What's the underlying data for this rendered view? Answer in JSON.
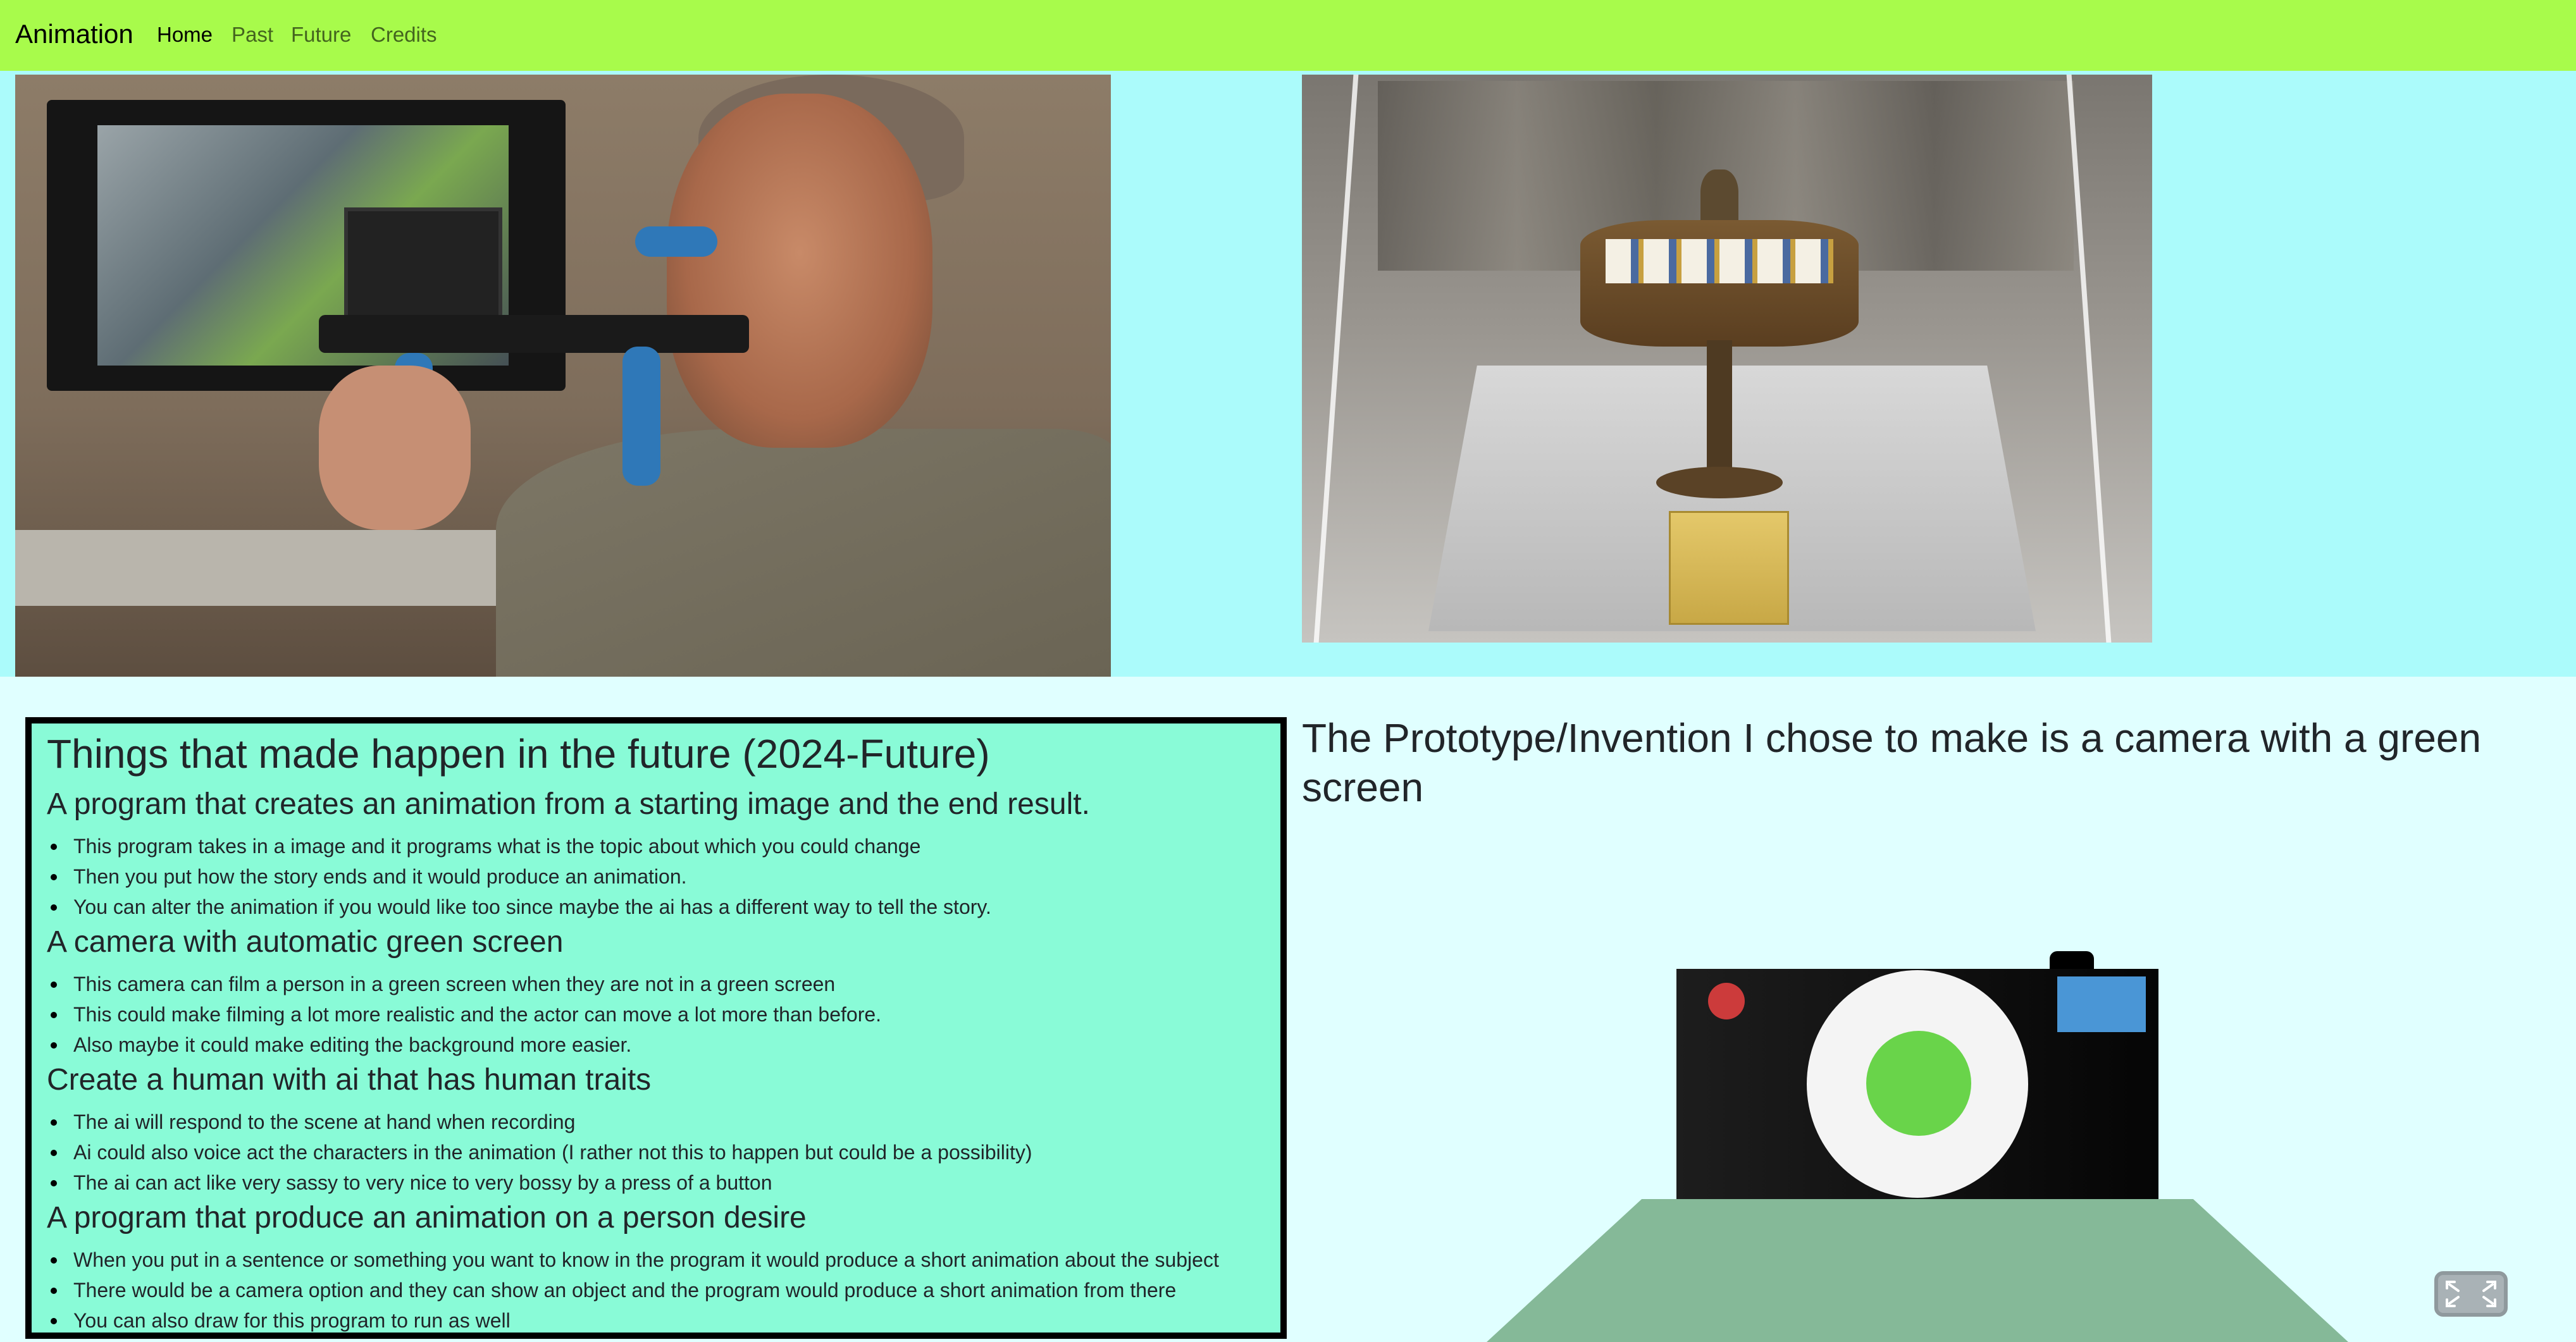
{
  "navbar": {
    "brand": "Animation",
    "links": [
      {
        "label": "Home",
        "active": true
      },
      {
        "label": "Past",
        "active": false
      },
      {
        "label": "Future",
        "active": false
      },
      {
        "label": "Credits",
        "active": false
      }
    ],
    "background": "#a8fb4b"
  },
  "images": [
    {
      "name": "man-with-camera-rig-photo"
    },
    {
      "name": "zoetrope-display-photo"
    }
  ],
  "future": {
    "title": "Things that made happen in the future (2024-Future)",
    "sections": [
      {
        "heading": "A program that creates an animation from a starting image and the end result.",
        "bullets": [
          "This program takes in a image and it programs what is the topic about which you could change",
          "Then you put how the story ends and it would produce an animation.",
          "You can alter the animation if you would like too since maybe the ai has a different way to tell the story."
        ]
      },
      {
        "heading": "A camera with automatic green screen",
        "bullets": [
          "This camera can film a person in a green screen when they are not in a green screen",
          "This could make filming a lot more realistic and the actor can move a lot more than before.",
          "Also maybe it could make editing the background more easier."
        ]
      },
      {
        "heading": "Create a human with ai that has human traits",
        "bullets": [
          "The ai will respond to the scene at hand when recording",
          "Ai could also voice act the characters in the animation (I rather not this to happen but could be a possibility)",
          "The ai can act like very sassy to very nice to very bossy by a press of a button"
        ]
      },
      {
        "heading": "A program that produce an animation on a person desire",
        "bullets": [
          "When you put in a sentence or something you want to know in the program it would produce a short animation about the subject",
          "There would be a camera option and they can show an object and the program would produce a short animation from there",
          "You can also draw for this program to run as well"
        ]
      }
    ],
    "panel_color": "#89fbd7"
  },
  "prototype": {
    "title": "The Prototype/Invention I chose to make is a camera with a green screen"
  },
  "colors": {
    "page_bg": "#e0ffff",
    "image_band_bg": "#abfbfb",
    "lens_green": "#69d44a",
    "flash_red": "#cc3b3b",
    "viewfinder_blue": "#4a96d6",
    "tripod_green": "#85b998"
  },
  "icons": {
    "fullscreen": "fullscreen-icon"
  }
}
